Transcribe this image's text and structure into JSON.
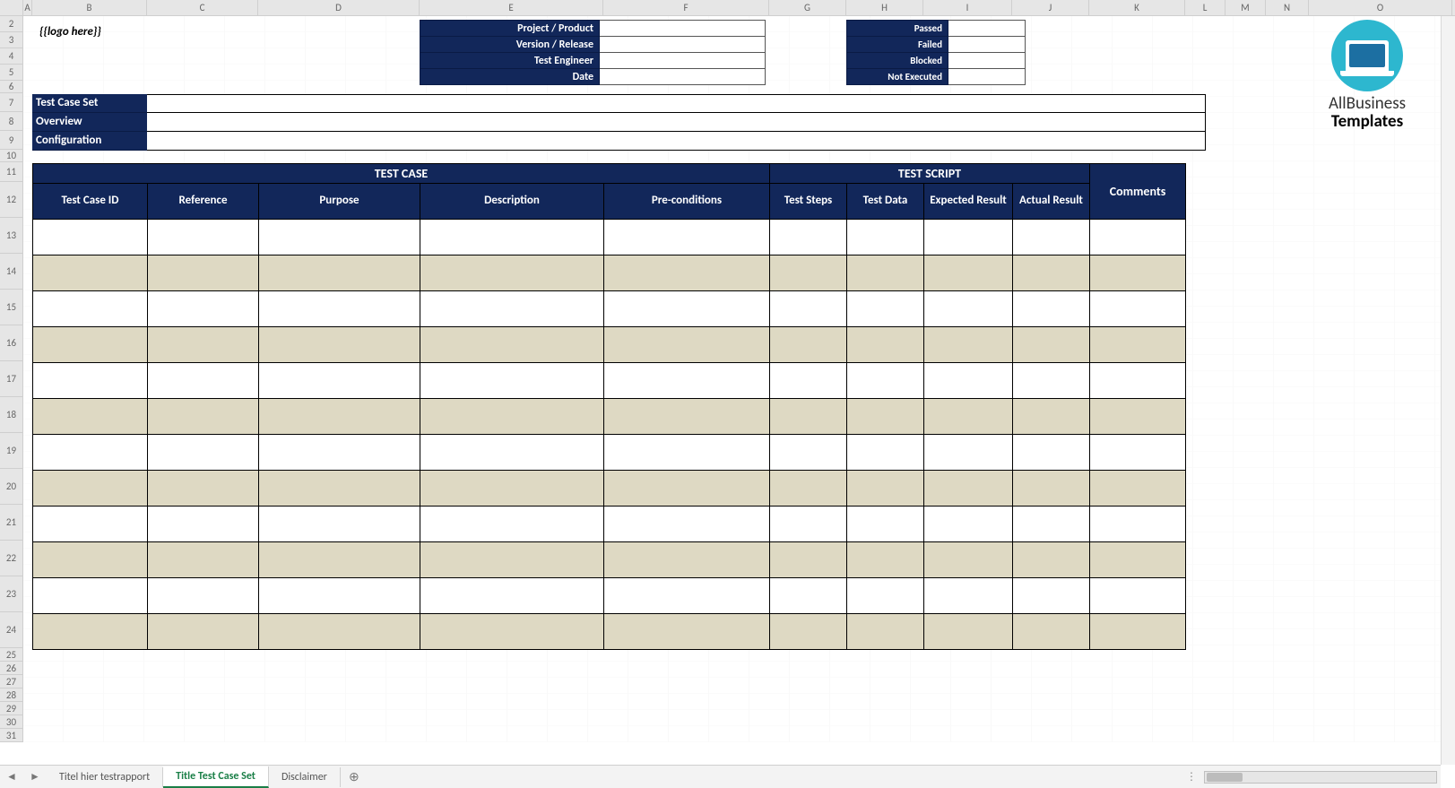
{
  "columns": [
    "A",
    "B",
    "C",
    "D",
    "E",
    "F",
    "G",
    "H",
    "I",
    "J",
    "K",
    "L",
    "M",
    "N",
    "O"
  ],
  "rows_left": [
    "2",
    "3",
    "4",
    "5",
    "6",
    "7",
    "8",
    "9",
    "10",
    "11",
    "12",
    "13",
    "14",
    "15",
    "16",
    "17",
    "18",
    "19",
    "20",
    "21",
    "22",
    "23",
    "24",
    "25",
    "26",
    "27",
    "28",
    "29",
    "30",
    "31"
  ],
  "logo_placeholder": "{{logo here}}",
  "info_left": {
    "project": "Project / Product",
    "version": "Version / Release",
    "engineer": "Test Engineer",
    "date": "Date"
  },
  "info_right": {
    "passed": "Passed",
    "failed": "Failed",
    "blocked": "Blocked",
    "not_executed": "Not Executed"
  },
  "meta": {
    "test_case_set": "Test Case Set",
    "overview": "Overview",
    "configuration": "Configuration"
  },
  "main": {
    "group_test_case": "TEST CASE",
    "group_test_script": "TEST SCRIPT",
    "group_comments": "Comments",
    "h_test_case_id": "Test Case ID",
    "h_reference": "Reference",
    "h_purpose": "Purpose",
    "h_description": "Description",
    "h_preconditions": "Pre-conditions",
    "h_test_steps": "Test Steps",
    "h_test_data": "Test Data",
    "h_expected": "Expected Result",
    "h_actual": "Actual Result"
  },
  "logo_text_top": "AllBusiness",
  "logo_text_bottom": "Templates",
  "tabs": {
    "t1": "Titel hier testrapport",
    "t2": "Title Test Case Set",
    "t3": "Disclaimer"
  }
}
